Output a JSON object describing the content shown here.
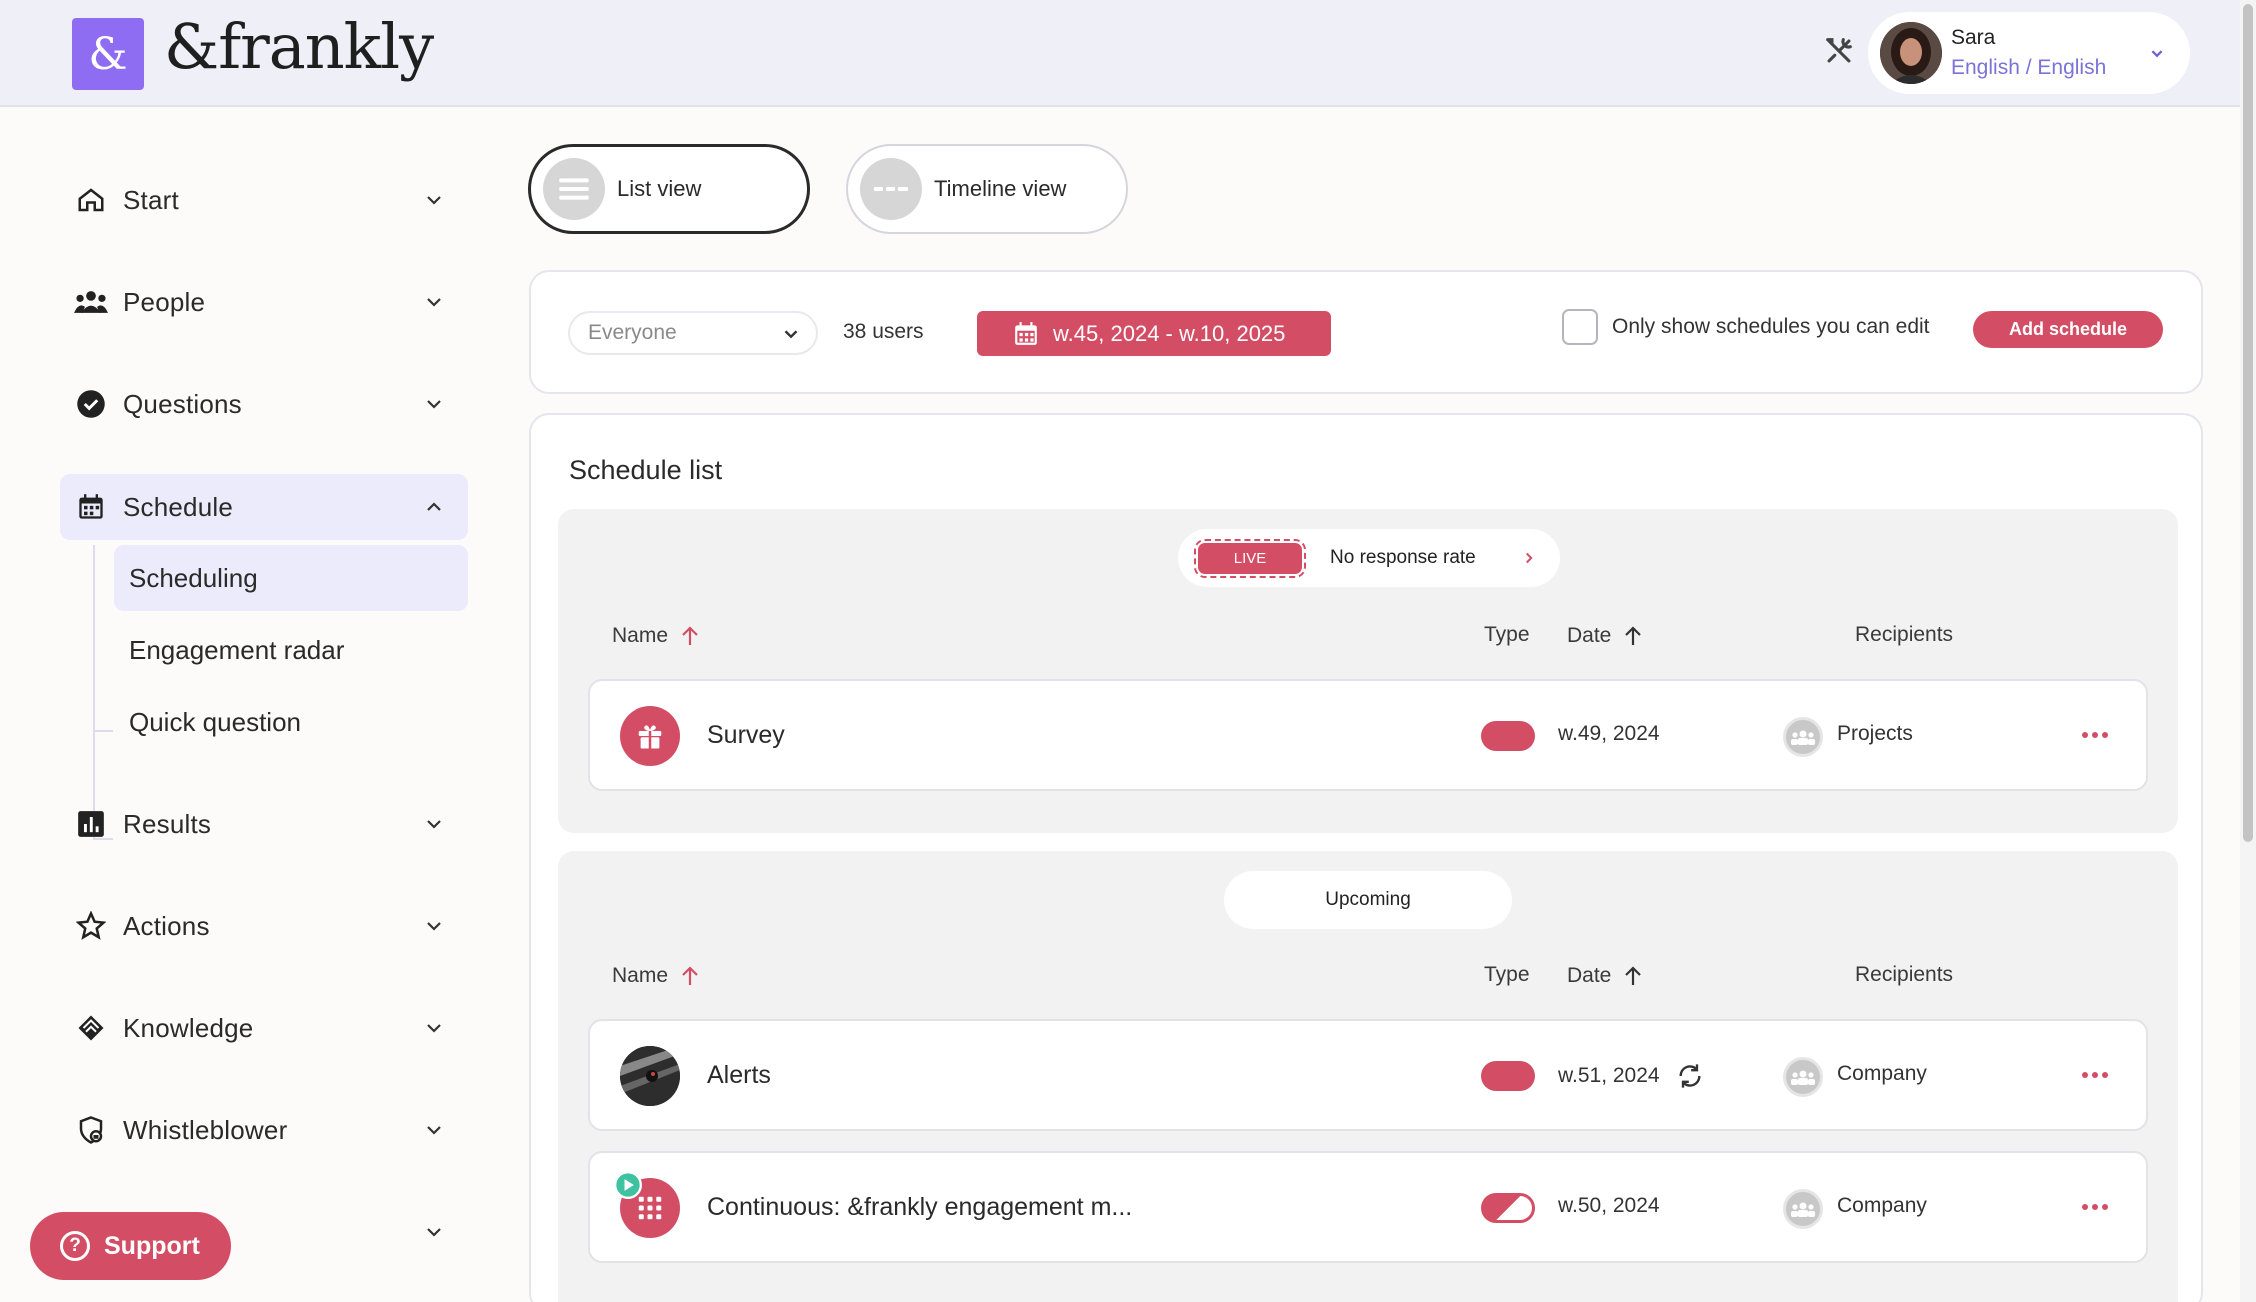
{
  "header": {
    "logo_symbol": "&",
    "logo_text": "&frankly",
    "user": {
      "name": "Sara",
      "language": "English / English"
    }
  },
  "sidebar": {
    "items": [
      {
        "label": "Start",
        "icon": "home-icon"
      },
      {
        "label": "People",
        "icon": "people-icon"
      },
      {
        "label": "Questions",
        "icon": "check-circle-icon"
      },
      {
        "label": "Schedule",
        "icon": "calendar-icon",
        "expanded": true
      },
      {
        "label": "Results",
        "icon": "bar-chart-icon"
      },
      {
        "label": "Actions",
        "icon": "star-icon"
      },
      {
        "label": "Knowledge",
        "icon": "knowledge-icon"
      },
      {
        "label": "Whistleblower",
        "icon": "shield-lock-icon"
      }
    ],
    "sub_items": [
      "Scheduling",
      "Engagement radar",
      "Quick question"
    ],
    "active_sub_item": "Scheduling",
    "support_label": "Support"
  },
  "views": {
    "list_label": "List view",
    "timeline_label": "Timeline view",
    "selected": "list"
  },
  "filters": {
    "audience": "Everyone",
    "user_count": "38 users",
    "date_range": "w.45, 2024 - w.10, 2025",
    "only_editable_label": "Only show schedules you can edit",
    "only_editable_checked": false,
    "add_button": "Add schedule"
  },
  "schedule": {
    "title": "Schedule list",
    "columns": {
      "name": "Name",
      "type": "Type",
      "date": "Date",
      "recipients": "Recipients"
    },
    "live": {
      "badge": "LIVE",
      "label": "No response rate",
      "rows": [
        {
          "name": "Survey",
          "date": "w.49, 2024",
          "recipients": "Projects"
        }
      ]
    },
    "upcoming": {
      "label": "Upcoming",
      "rows": [
        {
          "name": "Alerts",
          "date": "w.51, 2024",
          "recipients": "Company",
          "recurring": true
        },
        {
          "name": "Continuous: &frankly engagement m...",
          "date": "w.50, 2024",
          "recipients": "Company"
        }
      ]
    }
  },
  "colors": {
    "accent": "#d34e65",
    "brand": "#8f6df3",
    "nav_active": "#ebebfb"
  }
}
